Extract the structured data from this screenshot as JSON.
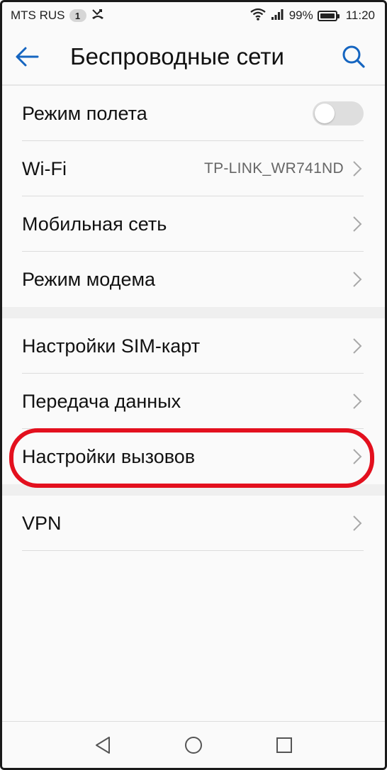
{
  "status_bar": {
    "carrier": "MTS RUS",
    "sim_badge": "1",
    "battery_percent": "99%",
    "time": "11:20"
  },
  "app_bar": {
    "title": "Беспроводные сети",
    "icons": {
      "back": "arrow-back-icon",
      "search": "search-icon"
    },
    "accent_color": "#1565c0"
  },
  "settings": {
    "group1": [
      {
        "label": "Режим полета",
        "control": "toggle",
        "toggle_on": false
      },
      {
        "label": "Wi-Fi",
        "value": "TP-LINK_WR741ND",
        "control": "chevron"
      },
      {
        "label": "Мобильная сеть",
        "control": "chevron"
      },
      {
        "label": "Режим модема",
        "control": "chevron"
      }
    ],
    "group2": [
      {
        "label": "Настройки SIM-карт",
        "control": "chevron"
      },
      {
        "label": "Передача данных",
        "control": "chevron"
      },
      {
        "label": "Настройки вызовов",
        "control": "chevron",
        "highlighted": true
      }
    ],
    "group3": [
      {
        "label": "VPN",
        "control": "chevron"
      }
    ]
  },
  "highlight_color": "#e3101e",
  "nav_bar": {
    "icons": [
      "back-triangle-icon",
      "home-circle-icon",
      "recents-square-icon"
    ]
  }
}
